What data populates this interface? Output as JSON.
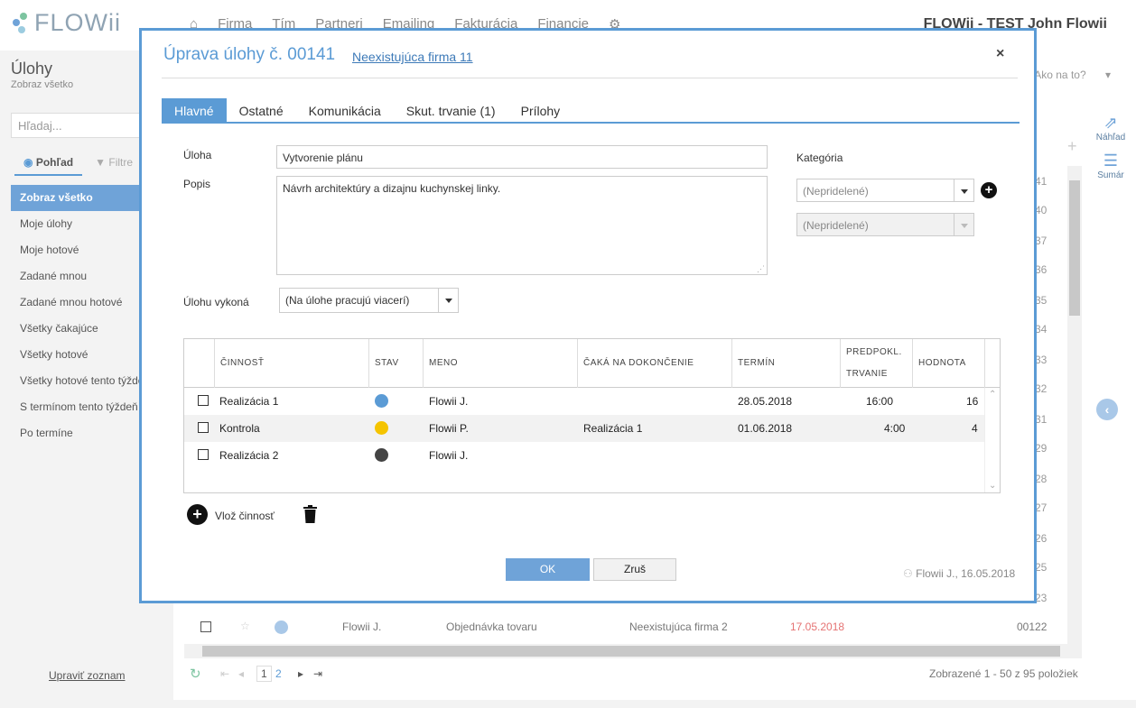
{
  "app": {
    "logo": "FLOWii",
    "nav": [
      "Firma",
      "Tím",
      "Partneri",
      "Emailing",
      "Fakturácia",
      "Financie"
    ],
    "user": "FLOWii - TEST John Flowii"
  },
  "sidebar": {
    "title": "Úlohy",
    "subtitle": "Zobraz všetko",
    "search_placeholder": "Hľadaj...",
    "tab_view": "Pohľad",
    "tab_filter": "Filtre",
    "items": [
      "Zobraz všetko",
      "Moje úlohy",
      "Moje hotové",
      "Zadané mnou",
      "Zadané mnou hotové",
      "Všetky čakajúce",
      "Všetky hotové",
      "Všetky hotové tento týždeň",
      "S termínom tento týždeň",
      "Po termíne"
    ],
    "edit_list": "Upraviť zoznam"
  },
  "main": {
    "help": "Ako na to?",
    "preview": "Náhľad",
    "summary": "Sumár",
    "row_numbers": [
      "41",
      "40",
      "37",
      "36",
      "35",
      "34",
      "33",
      "32",
      "31",
      "29",
      "28",
      "27",
      "26",
      "25",
      "23"
    ],
    "bottom_row": {
      "name": "Flowii J.",
      "title": "Objednávka tovaru",
      "company": "Neexistujúca firma 2",
      "date": "17.05.2018",
      "number": "00122"
    },
    "pager": {
      "pages": [
        "1",
        "2"
      ],
      "summary": "Zobrazené 1 - 50 z 95 položiek"
    }
  },
  "modal": {
    "title": "Úprava úlohy č. 00141",
    "company_link": "Neexistujúca firma 11",
    "close": "×",
    "tabs": [
      "Hlavné",
      "Ostatné",
      "Komunikácia",
      "Skut. trvanie (1)",
      "Prílohy"
    ],
    "task_label": "Úloha",
    "task_value": "Vytvorenie plánu",
    "desc_label": "Popis",
    "desc_value": "Návrh architektúry a dizajnu kuchynskej linky.",
    "category_label": "Kategória",
    "category_value": "(Nepridelené)",
    "subcategory_value": "(Nepridelené)",
    "assignee_label": "Úlohu vykoná",
    "assignee_value": "(Na úlohe pracujú viacerí)",
    "grid": {
      "headers": [
        "ČINNOSŤ",
        "STAV",
        "MENO",
        "ČAKÁ NA DOKONČENIE",
        "TERMÍN",
        "PREDPOKL. TRVANIE",
        "HODNOTA"
      ],
      "rows": [
        {
          "activity": "Realizácia 1",
          "status": "waiting",
          "name": "Flowii J.",
          "waits_for": "",
          "deadline": "28.05.2018",
          "duration": "16:00",
          "value": "16"
        },
        {
          "activity": "Kontrola",
          "status": "running",
          "name": "Flowii P.",
          "waits_for": "Realizácia 1",
          "deadline": "01.06.2018",
          "duration": "4:00",
          "value": "4"
        },
        {
          "activity": "Realizácia 2",
          "status": "paused",
          "name": "Flowii J.",
          "waits_for": "",
          "deadline": "",
          "duration": "",
          "value": ""
        }
      ]
    },
    "add_activity": "Vlož činnosť",
    "ok": "OK",
    "cancel": "Zruš",
    "footer": "Flowii J., 16.05.2018",
    "colors": {
      "accent": "#5b9bd5",
      "running": "#f5c400",
      "waiting": "#5b9bd5",
      "paused": "#444444"
    }
  }
}
